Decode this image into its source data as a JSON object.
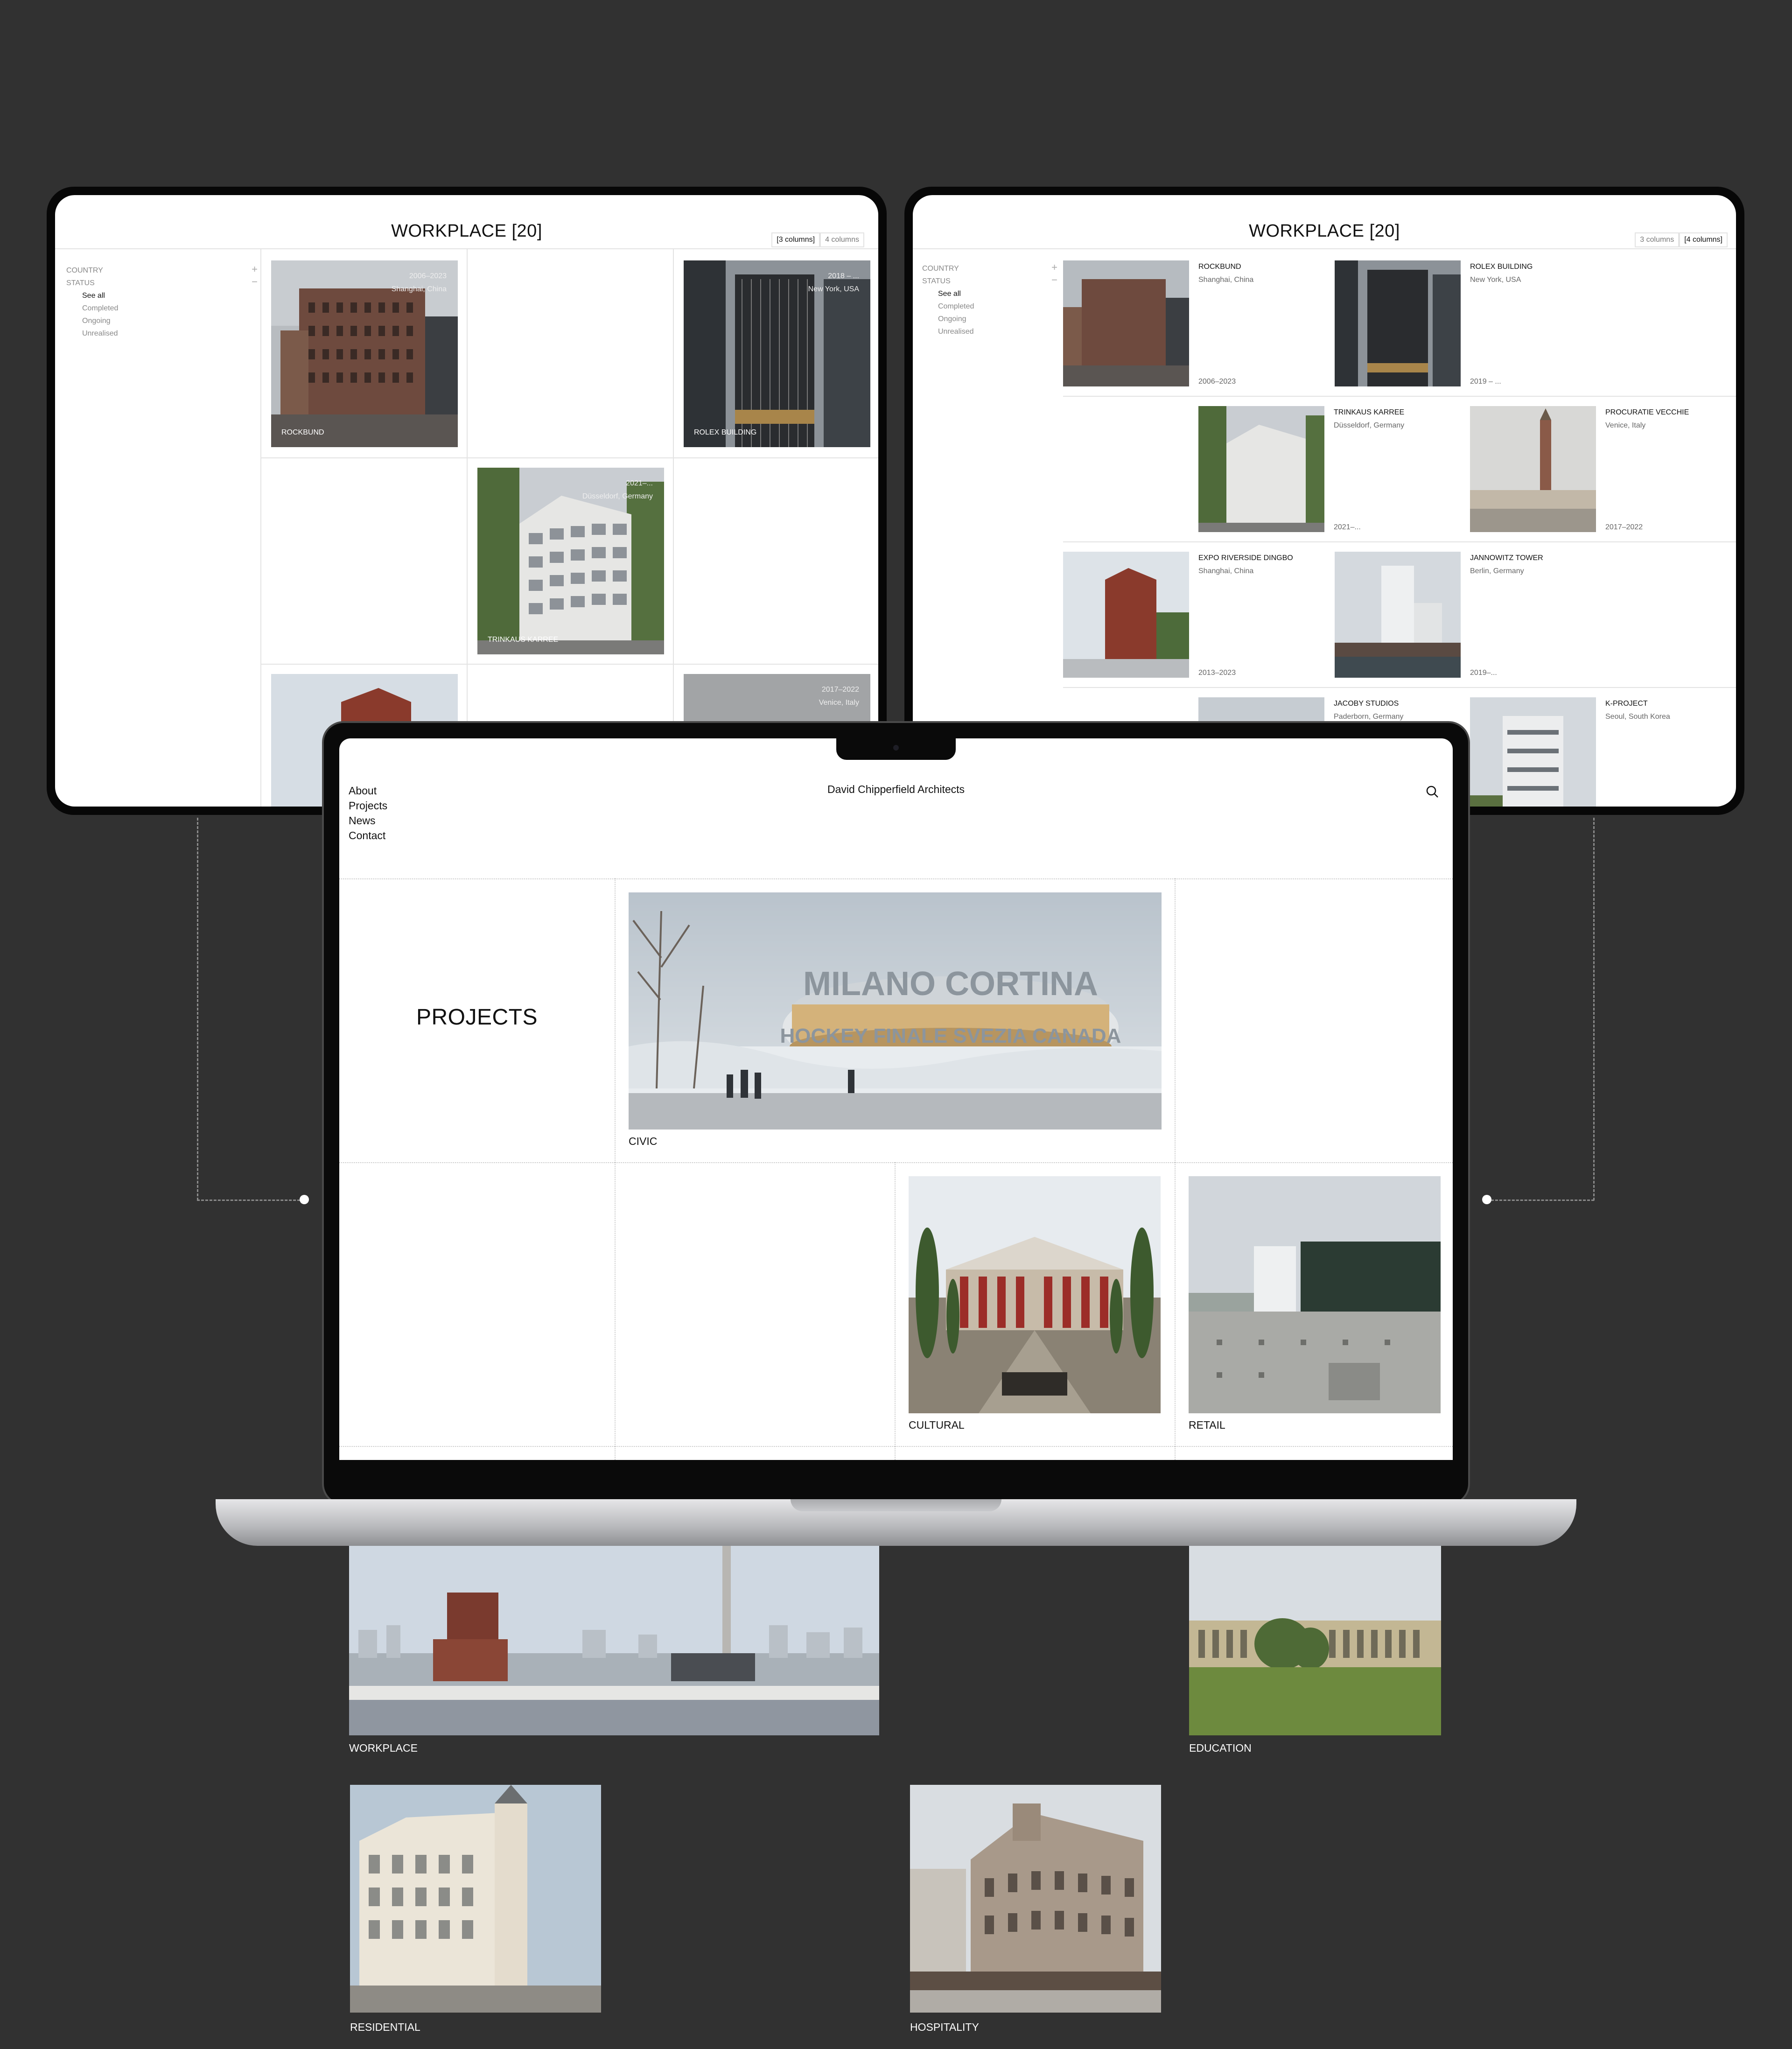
{
  "left_tablet": {
    "title": "WORKPLACE [20]",
    "col3": "[3 columns]",
    "col4": "4 columns",
    "filters": {
      "country": "COUNTRY",
      "status": "STATUS",
      "options": [
        "See all",
        "Completed",
        "Ongoing",
        "Unrealised"
      ]
    },
    "cards": [
      {
        "name": "ROCKBUND",
        "year": "2006–2023",
        "place": "Shanghai, China"
      },
      {
        "name": "ROLEX BUILDING",
        "year": "2018 – ...",
        "place": "New York, USA"
      },
      {
        "name": "TRINKAUS KARREE",
        "year": "2021–...",
        "place": "Düsseldorf, Germany"
      },
      {
        "name": "",
        "year": "2017–2022",
        "place": "Venice, Italy"
      }
    ]
  },
  "right_tablet": {
    "title": "WORKPLACE [20]",
    "col3": "3 columns",
    "col4": "[4 columns]",
    "filters": {
      "country": "COUNTRY",
      "status": "STATUS",
      "options": [
        "See all",
        "Completed",
        "Ongoing",
        "Unrealised"
      ]
    },
    "items": [
      {
        "name": "ROCKBUND",
        "place": "Shanghai, China",
        "year": "2006–2023"
      },
      {
        "name": "ROLEX BUILDING",
        "place": "New York, USA",
        "year": "2019 – ..."
      },
      {
        "name": "TRINKAUS KARREE",
        "place": "Düsseldorf, Germany",
        "year": "2021–..."
      },
      {
        "name": "PROCURATIE VECCHIE",
        "place": "Venice, Italy",
        "year": "2017–2022"
      },
      {
        "name": "EXPO RIVERSIDE DINGBO",
        "place": "Shanghai, China",
        "year": "2013–2023"
      },
      {
        "name": "JANNOWITZ TOWER",
        "place": "Berlin, Germany",
        "year": "2019–..."
      },
      {
        "name": "JACOBY STUDIOS",
        "place": "Paderborn, Germany",
        "year": ""
      },
      {
        "name": "K-PROJECT",
        "place": "Seoul, South Korea",
        "year": ""
      }
    ]
  },
  "laptop": {
    "nav": [
      "About",
      "Projects",
      "News",
      "Contact"
    ],
    "site_title": "David Chipperfield Architects",
    "page_heading": "PROJECTS",
    "categories": {
      "civic": "CIVIC",
      "cultural": "CULTURAL",
      "retail": "RETAIL"
    },
    "civic_sign_top": "MILANO CORTINA",
    "civic_sign_bottom": "HOCKEY FINALE SVEZIA CANADA"
  },
  "below": {
    "workplace": "WORKPLACE",
    "education": "EDUCATION",
    "residential": "RESIDENTIAL",
    "hospitality": "HOSPITALITY"
  }
}
